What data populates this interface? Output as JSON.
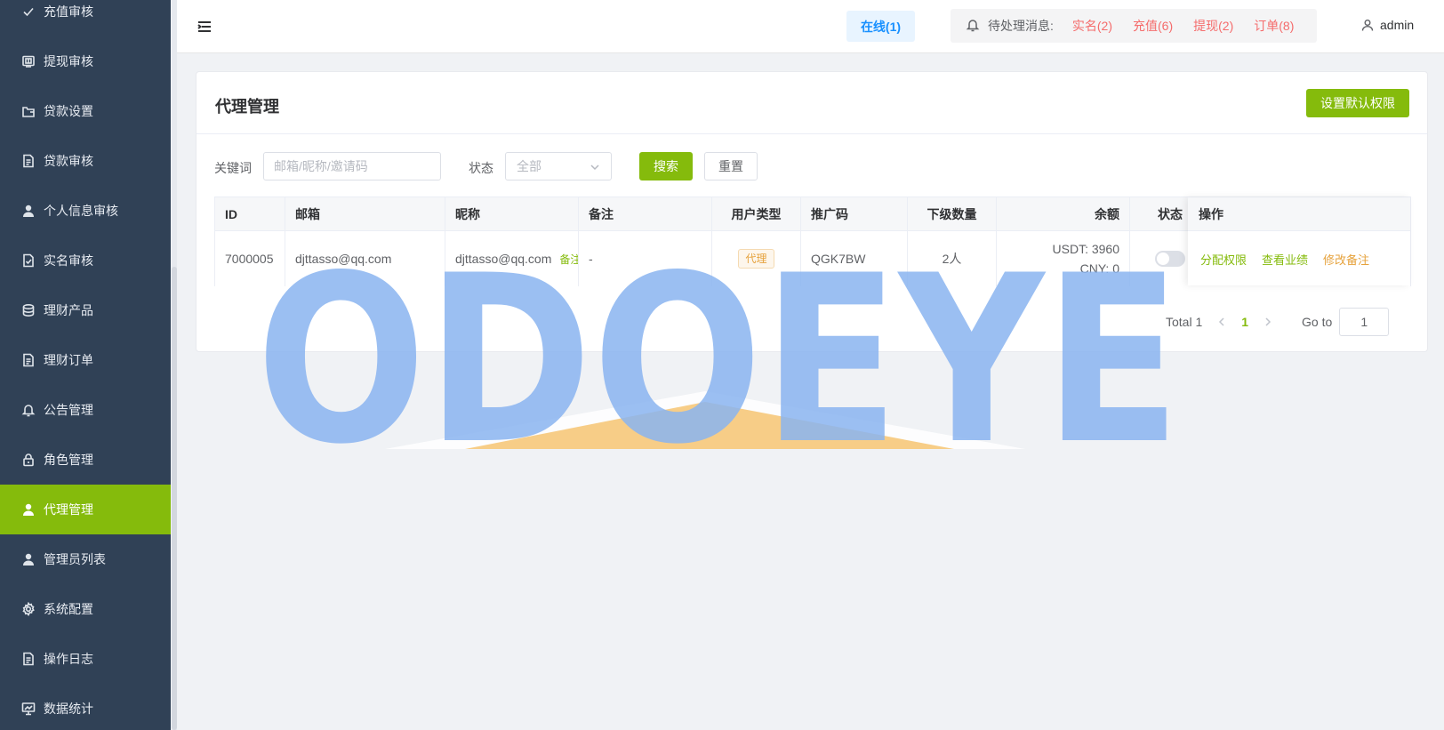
{
  "sidebar": {
    "items": [
      {
        "label": "充值审核",
        "icon": "check-icon"
      },
      {
        "label": "提现审核",
        "icon": "wallet-icon"
      },
      {
        "label": "贷款设置",
        "icon": "folder-icon"
      },
      {
        "label": "贷款审核",
        "icon": "document-icon"
      },
      {
        "label": "个人信息审核",
        "icon": "user-icon"
      },
      {
        "label": "实名审核",
        "icon": "document-check-icon"
      },
      {
        "label": "理财产品",
        "icon": "coins-icon"
      },
      {
        "label": "理财订单",
        "icon": "document-icon"
      },
      {
        "label": "公告管理",
        "icon": "bell-icon"
      },
      {
        "label": "角色管理",
        "icon": "lock-icon"
      },
      {
        "label": "代理管理",
        "icon": "user-icon",
        "active": true
      },
      {
        "label": "管理员列表",
        "icon": "user-icon"
      },
      {
        "label": "系统配置",
        "icon": "gear-icon"
      },
      {
        "label": "操作日志",
        "icon": "document-icon"
      },
      {
        "label": "数据统计",
        "icon": "chart-board-icon"
      }
    ]
  },
  "header": {
    "online": "在线(1)",
    "notify_label": "待处理消息:",
    "notify_links": [
      "实名(2)",
      "充值(6)",
      "提现(2)",
      "订单(8)"
    ],
    "user": "admin"
  },
  "card": {
    "title": "代理管理",
    "default_perm_button": "设置默认权限"
  },
  "filters": {
    "keyword_label": "关键词",
    "keyword_placeholder": "邮箱/昵称/邀请码",
    "status_label": "状态",
    "status_value": "全部",
    "search_button": "搜索",
    "reset_button": "重置"
  },
  "table": {
    "headers": {
      "id": "ID",
      "email": "邮箱",
      "nickname": "昵称",
      "remark": "备注",
      "user_type": "用户类型",
      "promo_code": "推广码",
      "sub_count": "下级数量",
      "balance": "余额",
      "status": "状态",
      "ops": "操作"
    },
    "rows": [
      {
        "id": "7000005",
        "email": "djttasso@qq.com",
        "nickname": "djttasso@qq.com",
        "nickname_link": "备注",
        "remark": "-",
        "user_type": "代理",
        "promo_code": "QGK7BW",
        "sub_count": "2人",
        "balance_usdt": "USDT: 3960",
        "balance_cny": "CNY: 0",
        "status_on": false,
        "ops": [
          "分配权限",
          "查看业绩",
          "修改备注"
        ]
      }
    ]
  },
  "pagination": {
    "total": "Total 1",
    "current": "1",
    "goto_label": "Go to",
    "goto_value": "1"
  },
  "watermark": {
    "text": "ODOEYE",
    "color_blue": "#8ab4f0",
    "color_orange": "#f6c87a"
  },
  "colors": {
    "accent": "#85bb0c",
    "sidebar_bg": "#304156",
    "danger": "#f56c6c",
    "warning": "#e6a23c",
    "info_blue": "#1890ff"
  }
}
